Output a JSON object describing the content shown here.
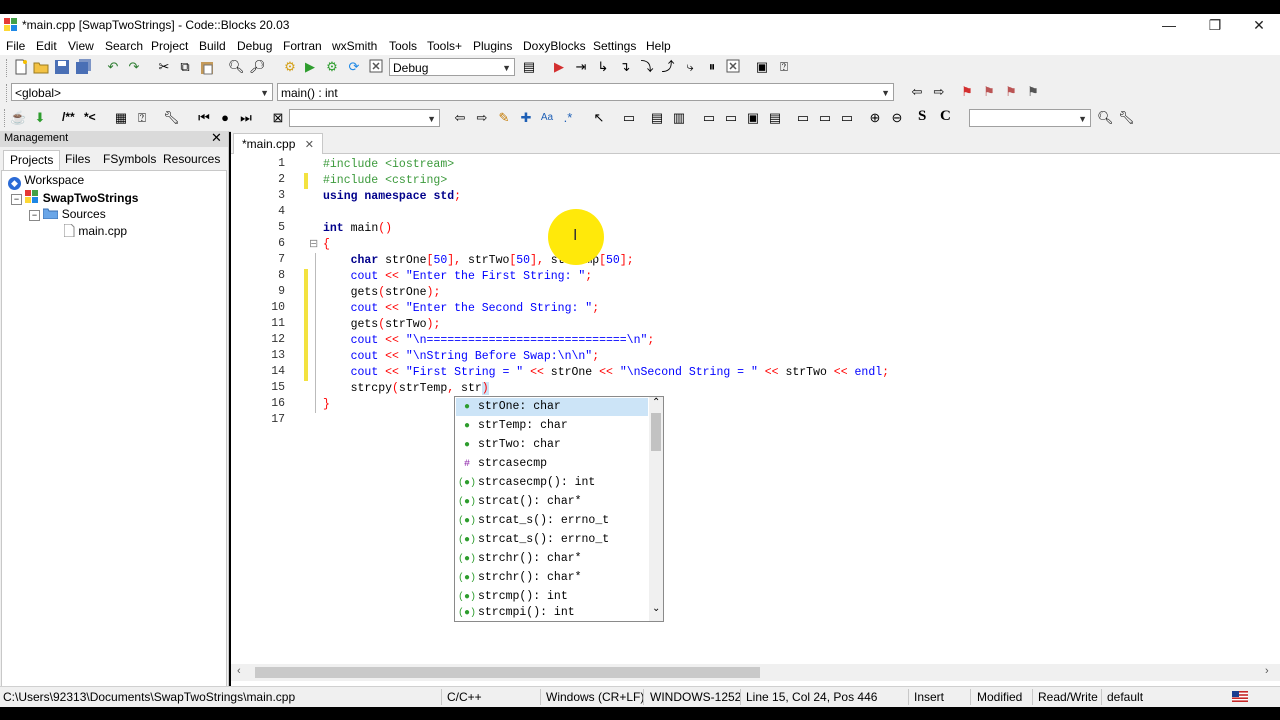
{
  "window": {
    "title": "*main.cpp [SwapTwoStrings] - Code::Blocks 20.03",
    "minimize": "—",
    "restore": "❐",
    "close": "✕"
  },
  "menu": [
    "File",
    "Edit",
    "View",
    "Search",
    "Project",
    "Build",
    "Debug",
    "Fortran",
    "wxSmith",
    "Tools",
    "Tools+",
    "Plugins",
    "DoxyBlocks",
    "Settings",
    "Help"
  ],
  "toolbar": {
    "build_target": "Debug",
    "scope": "<global>",
    "function": "main() : int",
    "comment_block": "/**",
    "comment_line": "*<",
    "bold_s": "S",
    "bold_c": "C"
  },
  "management": {
    "title": "Management",
    "close": "✕",
    "tabs": [
      "Projects",
      "Files",
      "FSymbols",
      "Resources"
    ],
    "tree": {
      "workspace": "Workspace",
      "project": "SwapTwoStrings",
      "folder": "Sources",
      "file": "main.cpp"
    }
  },
  "editor": {
    "tab_label": "*main.cpp",
    "tab_close": "✕",
    "line_numbers": [
      "1",
      "2",
      "3",
      "4",
      "5",
      "6",
      "7",
      "8",
      "9",
      "10",
      "11",
      "12",
      "13",
      "14",
      "15",
      "16",
      "17"
    ],
    "fold_open": "⊟"
  },
  "autocomplete": {
    "items": [
      {
        "icon": "●",
        "label": "strOne: char",
        "selected": true
      },
      {
        "icon": "●",
        "label": "strTemp: char",
        "selected": false
      },
      {
        "icon": "●",
        "label": "strTwo: char",
        "selected": false
      },
      {
        "icon": "#",
        "label": "strcasecmp",
        "selected": false
      },
      {
        "icon": "(●)",
        "label": "strcasecmp(): int",
        "selected": false
      },
      {
        "icon": "(●)",
        "label": "strcat(): char*",
        "selected": false
      },
      {
        "icon": "(●)",
        "label": "strcat_s(): errno_t",
        "selected": false
      },
      {
        "icon": "(●)",
        "label": "strcat_s(): errno_t",
        "selected": false
      },
      {
        "icon": "(●)",
        "label": "strchr(): char*",
        "selected": false
      },
      {
        "icon": "(●)",
        "label": "strchr(): char*",
        "selected": false
      },
      {
        "icon": "(●)",
        "label": "strcmp(): int",
        "selected": false
      },
      {
        "icon": "(●)",
        "label": "strcmpi(): int",
        "selected": false
      }
    ],
    "scroll_up": "⌃",
    "scroll_down": "⌄"
  },
  "status": {
    "path": "C:\\Users\\92313\\Documents\\SwapTwoStrings\\main.cpp",
    "language": "C/C++",
    "eol": "Windows (CR+LF)",
    "encoding": "WINDOWS-1252",
    "position": "Line 15, Col 24, Pos 446",
    "mode": "Insert",
    "modified": "Modified",
    "access": "Read/Write",
    "profile": "default"
  },
  "colors": {
    "preprocessor": "#3c9a3c",
    "keyword": "#00008b",
    "string": "#0000ff",
    "operator": "#ff0000",
    "modified_marker": "#f3e23f",
    "cursor_highlight": "#ffe90a",
    "selection": "#cce4f7"
  }
}
